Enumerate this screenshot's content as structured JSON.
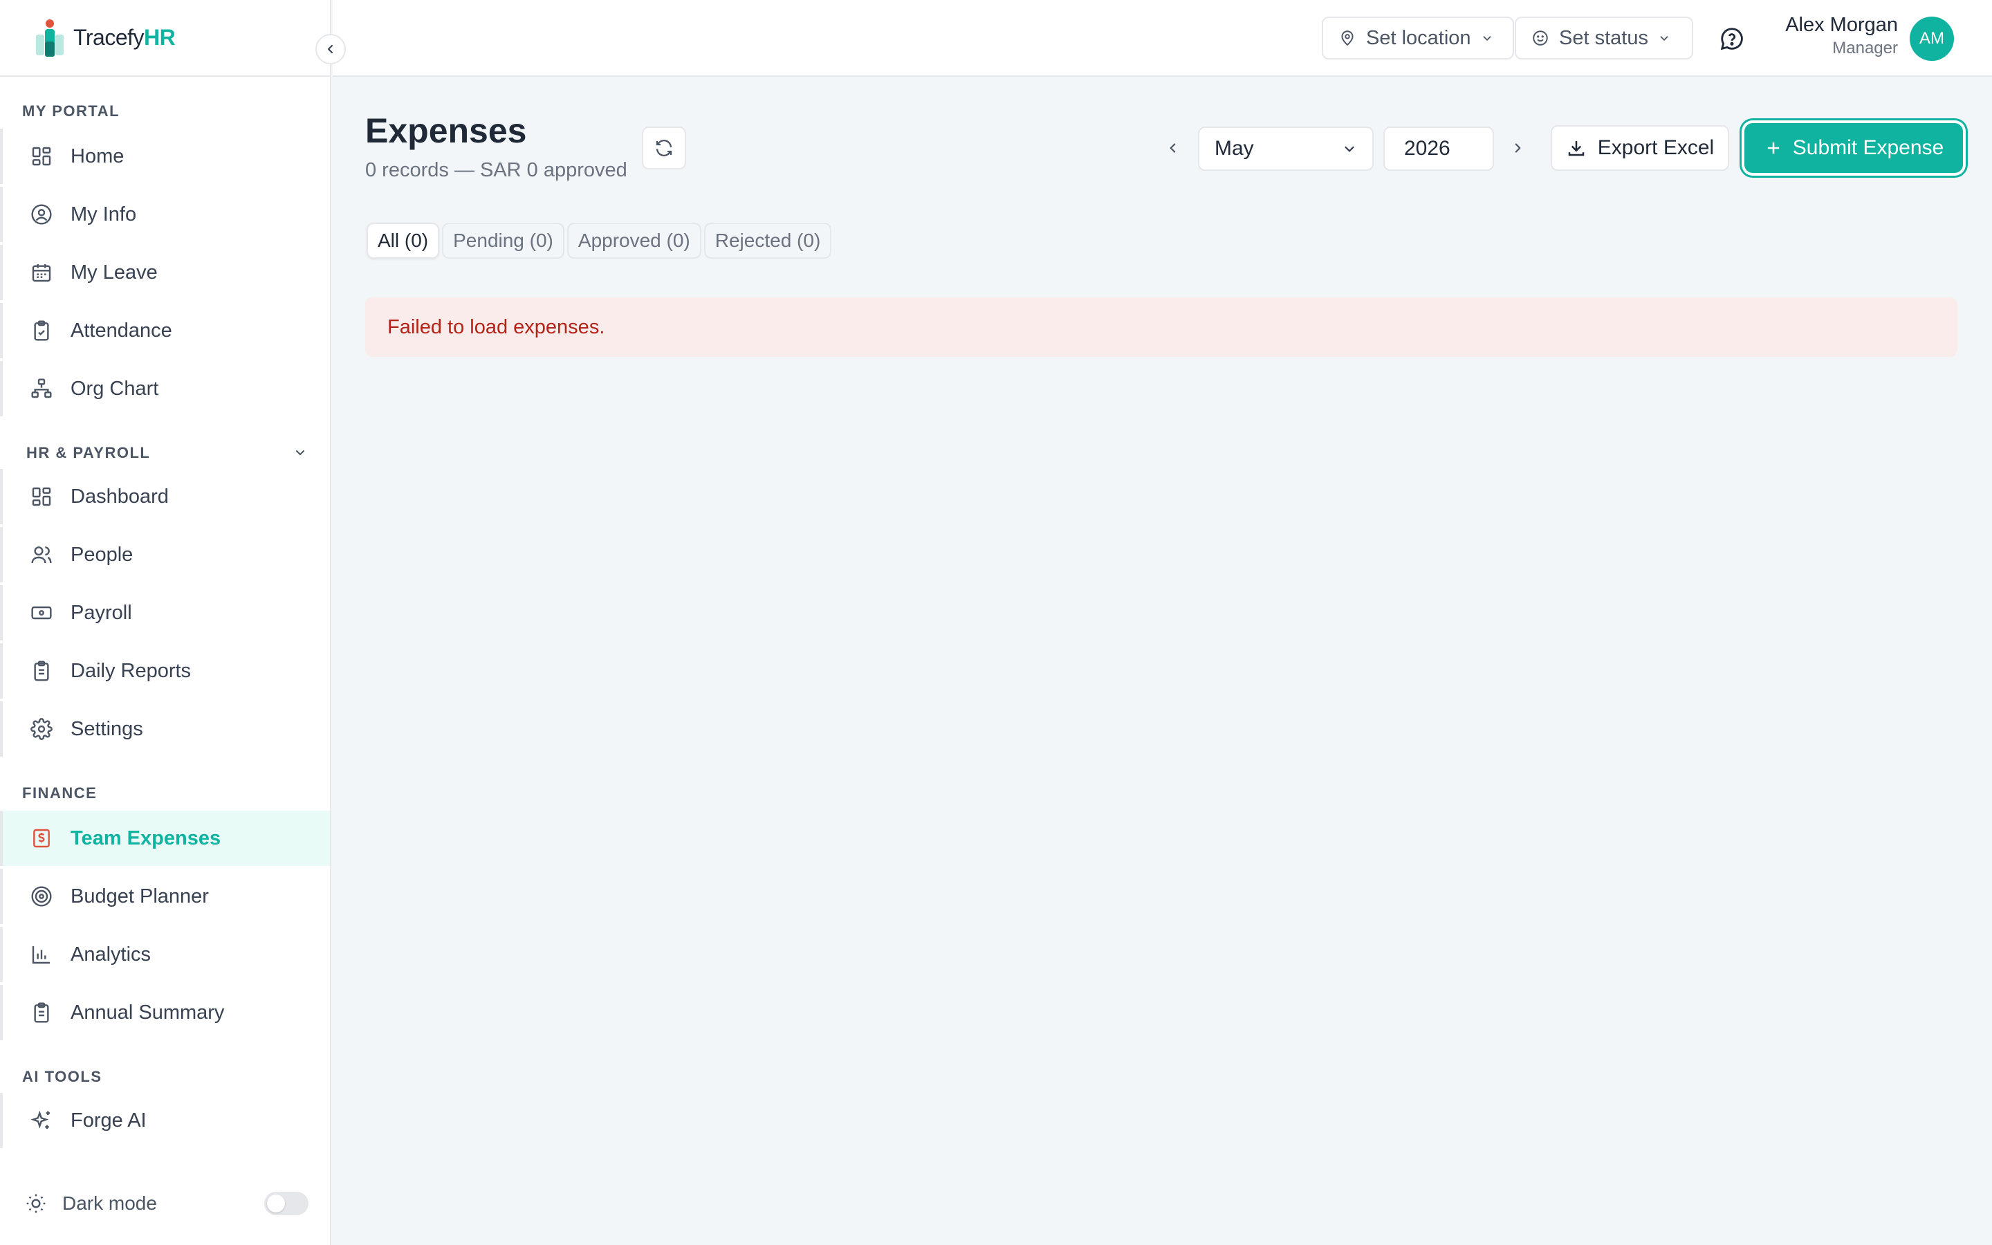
{
  "brand": {
    "name_part1": "Tracefy",
    "name_part2": "HR",
    "accent_color": "#10b3a0"
  },
  "sidebar": {
    "sections": {
      "my_portal": "MY PORTAL",
      "hr_payroll": "HR & PAYROLL",
      "finance": "FINANCE",
      "ai_tools": "AI TOOLS"
    },
    "items": {
      "home": {
        "label": "Home",
        "icon": "grid-icon"
      },
      "my_info": {
        "label": "My Info",
        "icon": "user-circle-icon"
      },
      "my_leave": {
        "label": "My Leave",
        "icon": "calendar-icon"
      },
      "attendance": {
        "label": "Attendance",
        "icon": "clipboard-check-icon"
      },
      "org_chart": {
        "label": "Org Chart",
        "icon": "org-chart-icon"
      },
      "dashboard": {
        "label": "Dashboard",
        "icon": "grid-icon"
      },
      "people": {
        "label": "People",
        "icon": "users-icon"
      },
      "payroll": {
        "label": "Payroll",
        "icon": "banknote-icon"
      },
      "daily_reports": {
        "label": "Daily Reports",
        "icon": "clipboard-list-icon"
      },
      "settings": {
        "label": "Settings",
        "icon": "gear-icon"
      },
      "team_expenses": {
        "label": "Team Expenses",
        "icon": "receipt-dollar-icon",
        "active": true
      },
      "budget_planner": {
        "label": "Budget Planner",
        "icon": "target-icon"
      },
      "analytics": {
        "label": "Analytics",
        "icon": "bar-chart-icon"
      },
      "annual_summary": {
        "label": "Annual Summary",
        "icon": "clipboard-list-icon"
      },
      "forge_ai": {
        "label": "Forge AI",
        "icon": "sparkles-icon"
      }
    },
    "dark_mode": {
      "label": "Dark mode",
      "enabled": false
    }
  },
  "topbar": {
    "set_location": "Set location",
    "set_status": "Set status",
    "user": {
      "name": "Alex Morgan",
      "role": "Manager",
      "initials": "AM"
    }
  },
  "main": {
    "title": "Expenses",
    "subtitle": "0 records — SAR 0 approved",
    "month": "May",
    "year": "2026",
    "export_label": "Export Excel",
    "submit_label": "Submit Expense",
    "tabs": [
      {
        "label": "All (0)",
        "active": true
      },
      {
        "label": "Pending (0)",
        "active": false
      },
      {
        "label": "Approved (0)",
        "active": false
      },
      {
        "label": "Rejected (0)",
        "active": false
      }
    ],
    "error_message": "Failed to load expenses."
  }
}
